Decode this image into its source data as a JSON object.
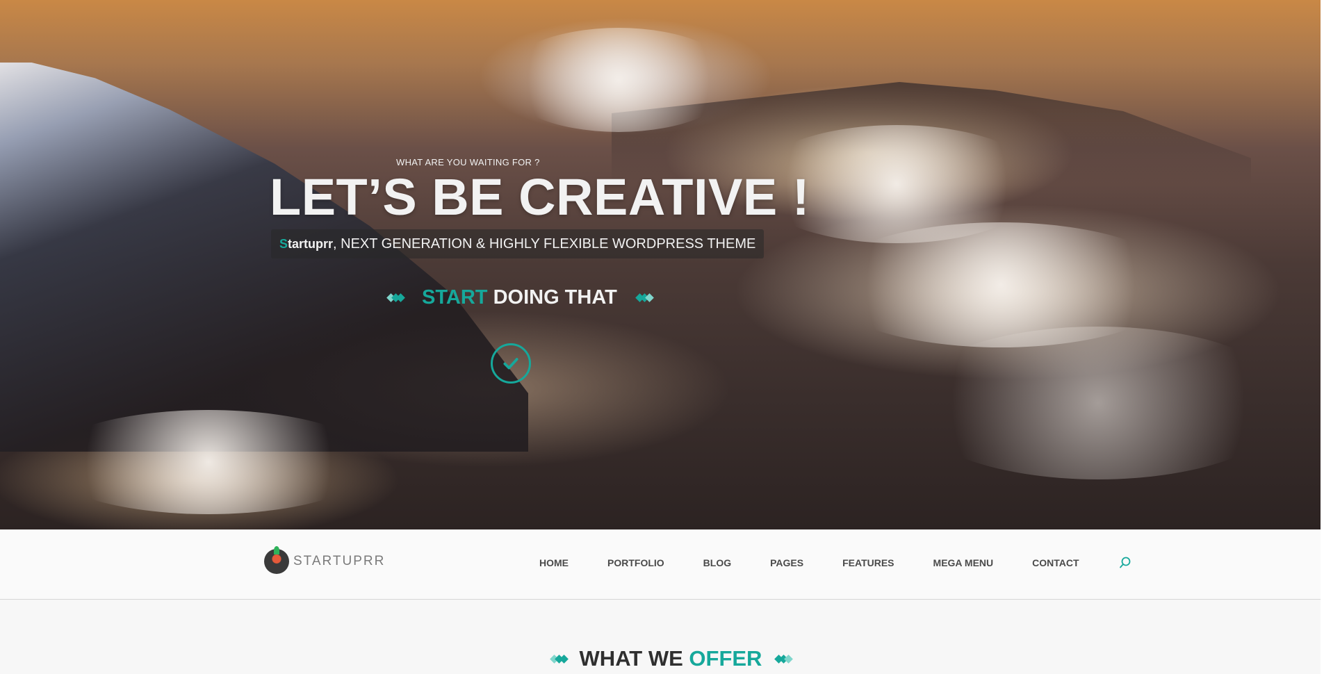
{
  "hero": {
    "pretitle": "WHAT ARE YOU WAITING FOR ?",
    "headline": "LET’S BE CREATIVE !",
    "tagline_brand_first": "S",
    "tagline_brand_rest": "tartuprr",
    "tagline_rest": ", NEXT GENERATION & HIGHLY FLEXIBLE WORDPRESS THEME",
    "cta_accent": "START",
    "cta_rest": " DOING THAT",
    "check_icon": "checkmark-icon"
  },
  "nav": {
    "logo_text": "STARTUPRR",
    "items": [
      "HOME",
      "PORTFOLIO",
      "BLOG",
      "PAGES",
      "FEATURES",
      "MEGA MENU",
      "CONTACT"
    ],
    "search_icon": "search-icon"
  },
  "section": {
    "title_main": "WHAT WE ",
    "title_accent": "OFFER"
  },
  "colors": {
    "accent": "#16a89b",
    "nav_text": "#4a4a4a",
    "nav_bg": "#fafafa"
  }
}
